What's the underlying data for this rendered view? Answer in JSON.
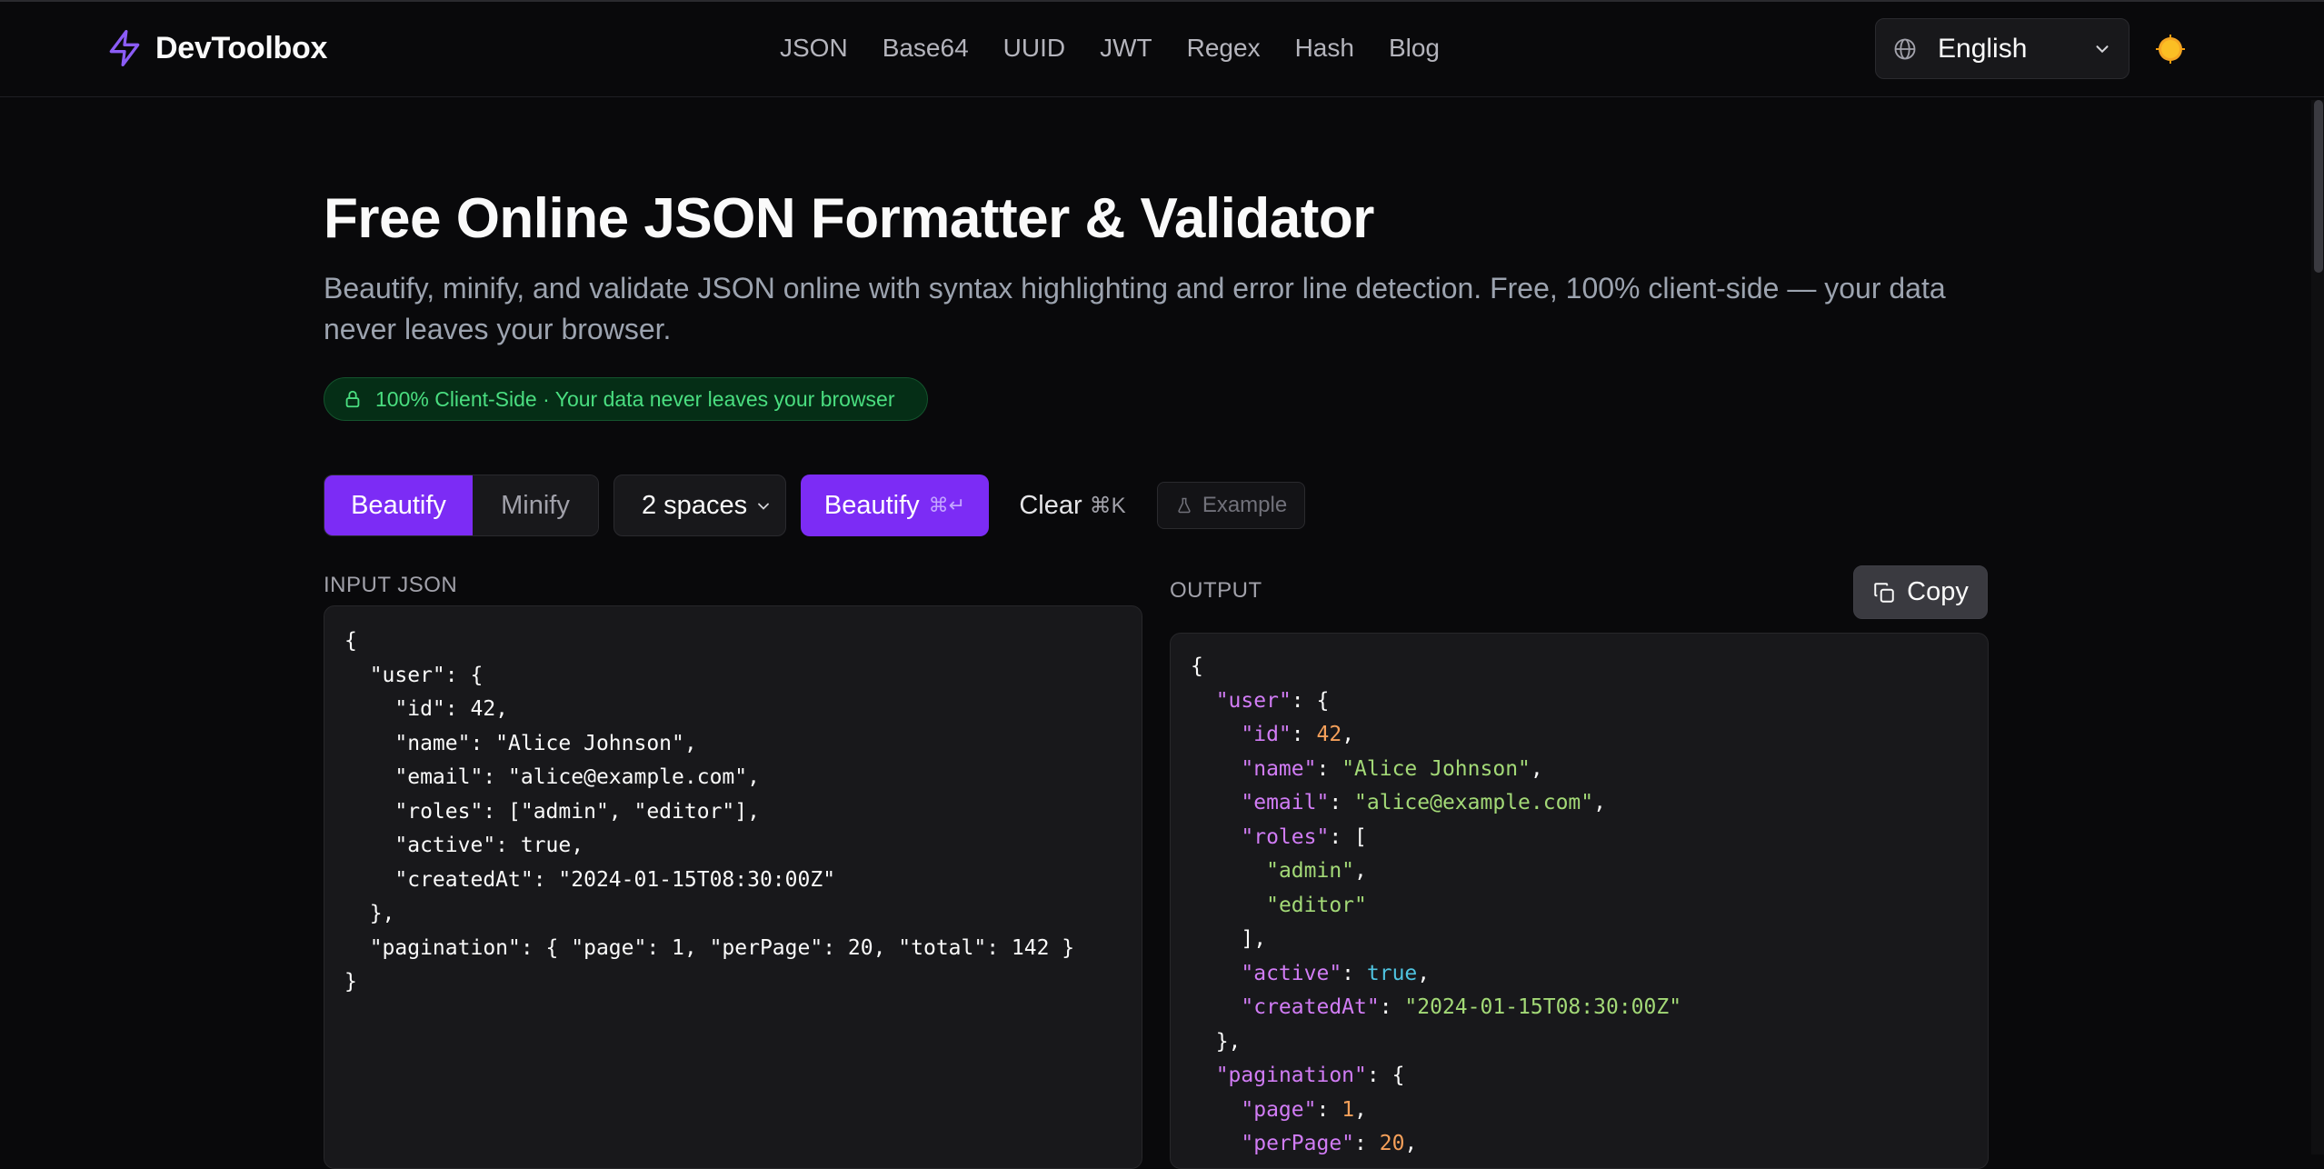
{
  "header": {
    "brand": "DevToolbox",
    "nav": [
      "JSON",
      "Base64",
      "UUID",
      "JWT",
      "Regex",
      "Hash",
      "Blog"
    ],
    "language": "English"
  },
  "hero": {
    "title": "Free Online JSON Formatter & Validator",
    "subtitle": "Beautify, minify, and validate JSON online with syntax highlighting and error line detection. Free, 100% client-side — your data never leaves your browser.",
    "badge": "100% Client-Side · Your data never leaves your browser"
  },
  "toolbar": {
    "mode_beautify": "Beautify",
    "mode_minify": "Minify",
    "indent": "2 spaces",
    "run_label": "Beautify",
    "run_shortcut": "⌘↵",
    "clear_label": "Clear",
    "clear_shortcut": "⌘K",
    "example_label": "Example"
  },
  "input": {
    "label": "INPUT JSON",
    "lines": [
      "{",
      "  \"user\": {",
      "    \"id\": 42,",
      "    \"name\": \"Alice Johnson\",",
      "    \"email\": \"alice@example.com\",",
      "    \"roles\": [\"admin\", \"editor\"],",
      "    \"active\": true,",
      "    \"createdAt\": \"2024-01-15T08:30:00Z\"",
      "  },",
      "  \"pagination\": { \"page\": 1, \"perPage\": 20, \"total\": 142 }",
      "}"
    ]
  },
  "output": {
    "label": "OUTPUT",
    "copy_label": "Copy",
    "lines": [
      [
        {
          "t": "punc",
          "v": "{"
        }
      ],
      [
        {
          "t": "punc",
          "v": "  "
        },
        {
          "t": "key",
          "v": "\"user\""
        },
        {
          "t": "punc",
          "v": ": {"
        }
      ],
      [
        {
          "t": "punc",
          "v": "    "
        },
        {
          "t": "key",
          "v": "\"id\""
        },
        {
          "t": "punc",
          "v": ": "
        },
        {
          "t": "num",
          "v": "42"
        },
        {
          "t": "punc",
          "v": ","
        }
      ],
      [
        {
          "t": "punc",
          "v": "    "
        },
        {
          "t": "key",
          "v": "\"name\""
        },
        {
          "t": "punc",
          "v": ": "
        },
        {
          "t": "str",
          "v": "\"Alice Johnson\""
        },
        {
          "t": "punc",
          "v": ","
        }
      ],
      [
        {
          "t": "punc",
          "v": "    "
        },
        {
          "t": "key",
          "v": "\"email\""
        },
        {
          "t": "punc",
          "v": ": "
        },
        {
          "t": "str",
          "v": "\"alice@example.com\""
        },
        {
          "t": "punc",
          "v": ","
        }
      ],
      [
        {
          "t": "punc",
          "v": "    "
        },
        {
          "t": "key",
          "v": "\"roles\""
        },
        {
          "t": "punc",
          "v": ": ["
        }
      ],
      [
        {
          "t": "punc",
          "v": "      "
        },
        {
          "t": "str",
          "v": "\"admin\""
        },
        {
          "t": "punc",
          "v": ","
        }
      ],
      [
        {
          "t": "punc",
          "v": "      "
        },
        {
          "t": "str",
          "v": "\"editor\""
        }
      ],
      [
        {
          "t": "punc",
          "v": "    ],"
        }
      ],
      [
        {
          "t": "punc",
          "v": "    "
        },
        {
          "t": "key",
          "v": "\"active\""
        },
        {
          "t": "punc",
          "v": ": "
        },
        {
          "t": "bool",
          "v": "true"
        },
        {
          "t": "punc",
          "v": ","
        }
      ],
      [
        {
          "t": "punc",
          "v": "    "
        },
        {
          "t": "key",
          "v": "\"createdAt\""
        },
        {
          "t": "punc",
          "v": ": "
        },
        {
          "t": "str",
          "v": "\"2024-01-15T08:30:00Z\""
        }
      ],
      [
        {
          "t": "punc",
          "v": "  },"
        }
      ],
      [
        {
          "t": "punc",
          "v": "  "
        },
        {
          "t": "key",
          "v": "\"pagination\""
        },
        {
          "t": "punc",
          "v": ": {"
        }
      ],
      [
        {
          "t": "punc",
          "v": "    "
        },
        {
          "t": "key",
          "v": "\"page\""
        },
        {
          "t": "punc",
          "v": ": "
        },
        {
          "t": "num",
          "v": "1"
        },
        {
          "t": "punc",
          "v": ","
        }
      ],
      [
        {
          "t": "punc",
          "v": "    "
        },
        {
          "t": "key",
          "v": "\"perPage\""
        },
        {
          "t": "punc",
          "v": ": "
        },
        {
          "t": "num",
          "v": "20"
        },
        {
          "t": "punc",
          "v": ","
        }
      ]
    ]
  },
  "colors": {
    "accent": "#7c2cf5",
    "json_key": "#d17cf5",
    "json_string": "#a3d977",
    "json_number": "#f5a05a",
    "json_boolean": "#4fc3e0",
    "badge_text": "#4ade80"
  },
  "icons": {
    "brand": "lightning-bolt-icon",
    "language": "globe-icon",
    "theme": "sun-icon",
    "badge": "lock-icon",
    "example": "flask-icon",
    "copy": "copy-icon"
  }
}
